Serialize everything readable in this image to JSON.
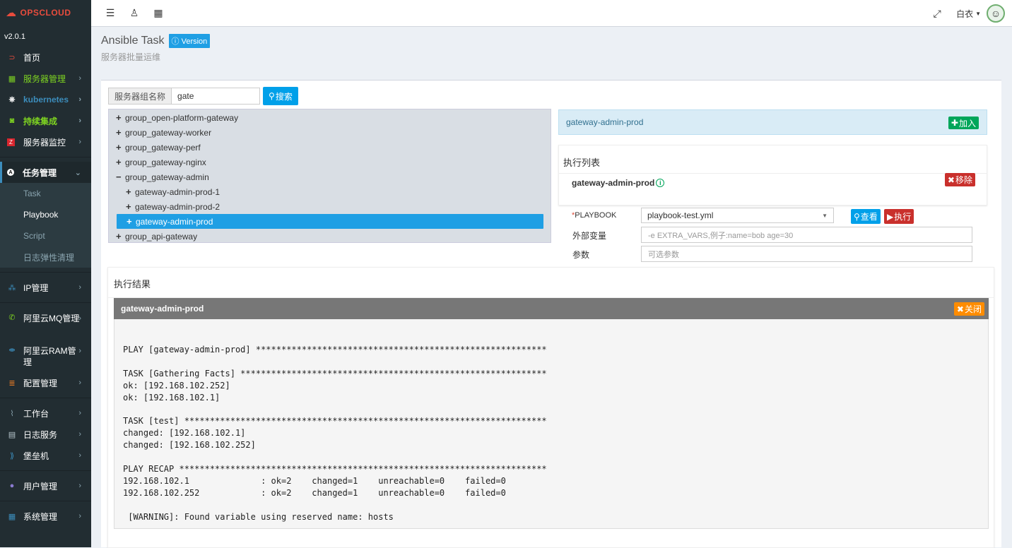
{
  "sidebar": {
    "logo": "OPSCLOUD",
    "version": "v2.0.1",
    "items": [
      {
        "label": "首页",
        "color": "#fff",
        "icon_color": "#e84c3d"
      },
      {
        "label": "服务器管理",
        "color": "#7ed321",
        "icon_color": "#7ed321"
      },
      {
        "label": "kubernetes",
        "color": "#3c8dbc",
        "icon_color": "#fff"
      },
      {
        "label": "持续集成",
        "color": "#7ed321",
        "icon_color": "#7ed321"
      },
      {
        "label": "服务器监控",
        "color": "#fff",
        "icon_color": "#e84c3d"
      },
      {
        "label": "任务管理",
        "color": "#fff"
      },
      {
        "label": "IP管理"
      },
      {
        "label": "阿里云MQ管理"
      },
      {
        "label": "阿里云RAM管理"
      },
      {
        "label": "配置管理"
      },
      {
        "label": "工作台"
      },
      {
        "label": "日志服务"
      },
      {
        "label": "堡垒机"
      },
      {
        "label": "用户管理"
      },
      {
        "label": "系统管理"
      }
    ],
    "sub_items": [
      "Task",
      "Playbook",
      "Script",
      "日志弹性清理"
    ]
  },
  "topbar": {
    "user": "白衣"
  },
  "header": {
    "title": "Ansible Task",
    "version_btn": "Version",
    "subtitle": "服务器批量运维"
  },
  "search": {
    "label": "服务器组名称",
    "value": "gate",
    "button": "搜索"
  },
  "tree": [
    {
      "label": "group_open-platform-gateway",
      "sign": "+"
    },
    {
      "label": "group_gateway-worker",
      "sign": "+"
    },
    {
      "label": "group_gateway-perf",
      "sign": "+"
    },
    {
      "label": "group_gateway-nginx",
      "sign": "+"
    },
    {
      "label": "group_gateway-admin",
      "sign": "−"
    },
    {
      "label": "gateway-admin-prod-1",
      "sign": "+"
    },
    {
      "label": "gateway-admin-prod-2",
      "sign": "+"
    },
    {
      "label": "gateway-admin-prod",
      "sign": "+"
    },
    {
      "label": "group_api-gateway",
      "sign": "+"
    }
  ],
  "selected": {
    "name": "gateway-admin-prod",
    "add_btn": "加入"
  },
  "exec_list": {
    "title": "执行列表",
    "item": "gateway-admin-prod",
    "remove_btn": "移除"
  },
  "form": {
    "playbook_label": "PLAYBOOK",
    "playbook_value": "playbook-test.yml",
    "view_btn": "查看",
    "exec_btn": "执行",
    "vars_label": "外部变量",
    "vars_placeholder": "-e EXTRA_VARS,例子:name=bob age=30",
    "params_label": "参数",
    "params_placeholder": "可选参数"
  },
  "result": {
    "title": "执行结果",
    "host": "gateway-admin-prod",
    "close_btn": "关闭",
    "output": "\nPLAY [gateway-admin-prod] *********************************************************\n\nTASK [Gathering Facts] ************************************************************\nok: [192.168.102.252]\nok: [192.168.102.1]\n\nTASK [test] ***********************************************************************\nchanged: [192.168.102.1]\nchanged: [192.168.102.252]\n\nPLAY RECAP ************************************************************************\n192.168.102.1              : ok=2    changed=1    unreachable=0    failed=0   \n192.168.102.252            : ok=2    changed=1    unreachable=0    failed=0   \n\n [WARNING]: Found variable using reserved name: hosts"
  }
}
